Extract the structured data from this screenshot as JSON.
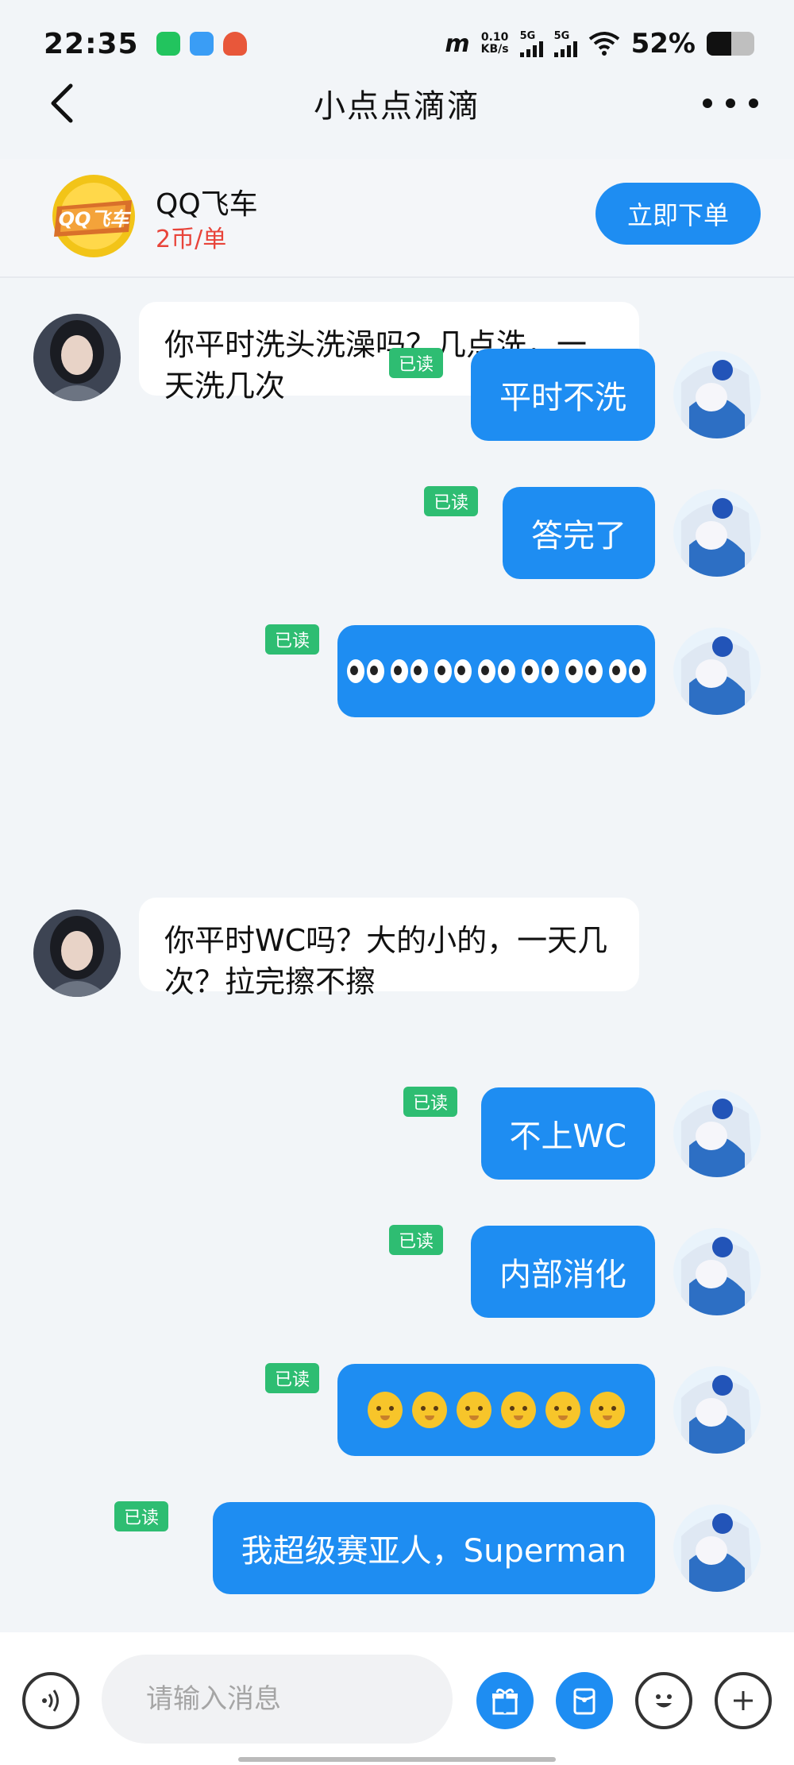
{
  "status_bar": {
    "time": "22:35",
    "net_speed_value": "0.10",
    "net_speed_unit": "KB/s",
    "sim1": "5G",
    "sim2": "5G",
    "battery_text": "52%",
    "battery_level": 0.52,
    "app_icons": [
      "wechat-icon",
      "app-icon",
      "game-icon"
    ]
  },
  "header": {
    "title": "小点点滴滴",
    "back_icon": "chevron-left-icon",
    "more_icon": "more-icon"
  },
  "service": {
    "logo_text": "QQ飞车",
    "name": "QQ飞车",
    "price": "2币/单",
    "order_button": "立即下单"
  },
  "messages": [
    {
      "side": "in",
      "text": "你平时洗头洗澡吗？几点洗，一天洗几次"
    },
    {
      "side": "out",
      "text": "平时不洗",
      "status": "已读"
    },
    {
      "side": "out",
      "text": "答完了",
      "status": "已读"
    },
    {
      "side": "out",
      "text": "👀👀👀👀👀👀👀",
      "status": "已读"
    },
    {
      "side": "in",
      "text": "你平时WC吗？大的小的，一天几次？拉完擦不擦"
    },
    {
      "side": "out",
      "text": "不上WC",
      "status": "已读"
    },
    {
      "side": "out",
      "text": "内部消化",
      "status": "已读"
    },
    {
      "side": "out",
      "text": "👶👶👶👶👶👶",
      "status": "已读"
    },
    {
      "side": "out",
      "text": "我超级赛亚人，Superman",
      "status": "已读"
    }
  ],
  "input_bar": {
    "placeholder": "请输入消息",
    "icons": [
      "voice-icon",
      "gift-icon",
      "red-packet-icon",
      "emoji-icon",
      "plus-icon"
    ]
  },
  "colors": {
    "accent": "#1e8df2",
    "read_badge": "#2ebd72",
    "price": "#e8443a",
    "background": "#f2f5f8"
  }
}
